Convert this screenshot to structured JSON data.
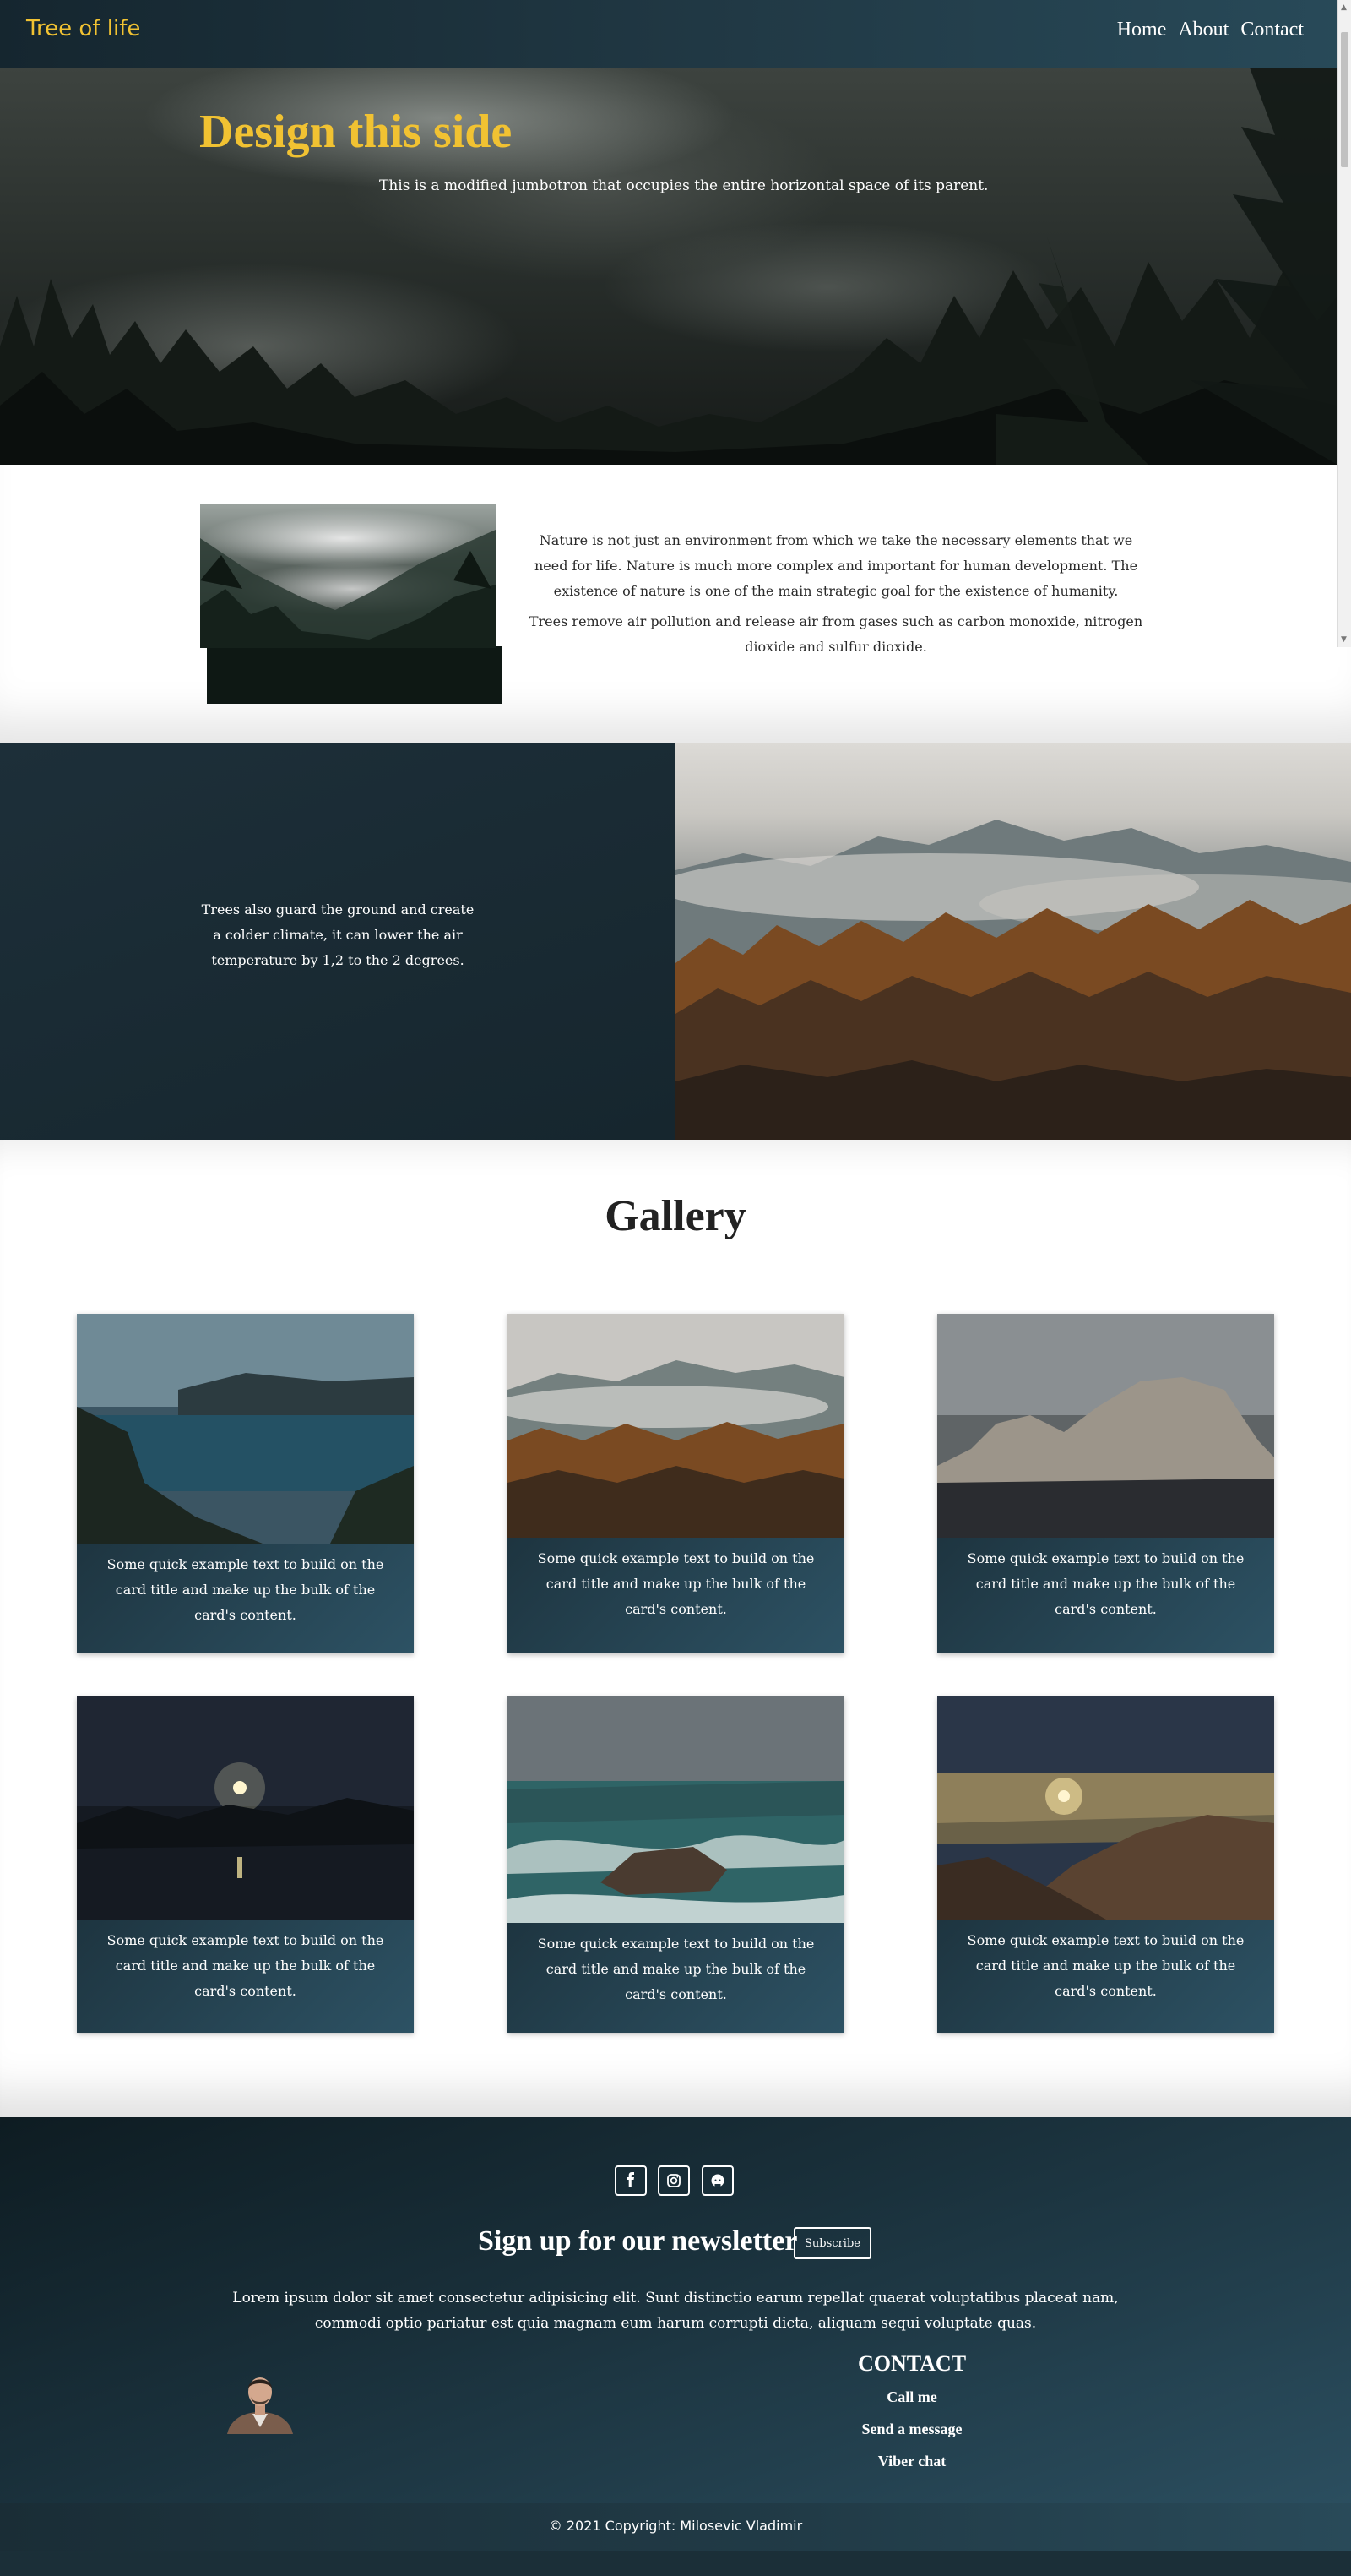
{
  "nav": {
    "brand": "Tree of life",
    "links": [
      "Home",
      "About",
      "Contact"
    ]
  },
  "hero": {
    "title": "Design this side",
    "subtitle": "This is a modified jumbotron that occupies the entire horizontal space of its parent."
  },
  "about": {
    "paragraphs": [
      "Nature is not just an environment from which we take the necessary elements that we need for life. Nature is much more complex and important for human development. The existence of nature is one of the main strategic goal for the existence of humanity.",
      "Trees remove air pollution and release air from gases such as carbon monoxide, nitrogen dioxide and sulfur dioxide."
    ]
  },
  "split": {
    "text": "Trees also guard the ground and create a colder climate, it can lower the air temperature by 1,2 to the 2 degrees."
  },
  "gallery": {
    "title": "Gallery",
    "cards": [
      {
        "text": "Some quick example text to build on the card title and make up the bulk of the card's content.",
        "image": "lake-mountains"
      },
      {
        "text": "Some quick example text to build on the card title and make up the bulk of the card's content.",
        "image": "autumn-forest-fog"
      },
      {
        "text": "Some quick example text to build on the card title and make up the bulk of the card's content.",
        "image": "sea-cliff"
      },
      {
        "text": "Some quick example text to build on the card title and make up the bulk of the card's content.",
        "image": "moonlit-lake"
      },
      {
        "text": "Some quick example text to build on the card title and make up the bulk of the card's content.",
        "image": "stormy-sea-rock"
      },
      {
        "text": "Some quick example text to build on the card title and make up the bulk of the card's content.",
        "image": "sunset-hills"
      }
    ]
  },
  "footer": {
    "social_icons": [
      "facebook-icon",
      "instagram-icon",
      "github-icon"
    ],
    "newsletter_title": "Sign up for our newsletter",
    "subscribe_label": "Subscribe",
    "lorem": "Lorem ipsum dolor sit amet consectetur adipisicing elit. Sunt distinctio earum repellat quaerat voluptatibus placeat nam, commodi optio pariatur est quia magnam eum harum corrupti dicta, aliquam sequi voluptate quas.",
    "contact_title": "CONTACT",
    "contact_links": [
      "Call me",
      "Send a message",
      "Viber chat"
    ],
    "copyright": "© 2021 Copyright: Milosevic Vladimir"
  },
  "colors": {
    "accent": "#f1c232",
    "dark": "#16262e",
    "teal": "#2d5264"
  }
}
